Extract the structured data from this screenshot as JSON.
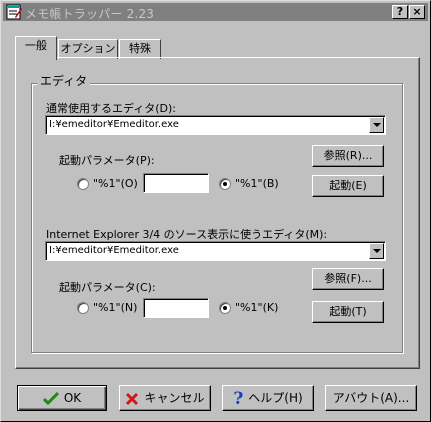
{
  "window": {
    "title": "メモ帳トラッパー 2.23",
    "help_button": "?",
    "close_button": "×"
  },
  "tabs": [
    {
      "label": "一般",
      "active": true
    },
    {
      "label": "オプション",
      "active": false
    },
    {
      "label": "特殊",
      "active": false
    }
  ],
  "group": {
    "title": "エディタ",
    "normal_editor": {
      "label": "通常使用するエディタ(D):",
      "value": "I:¥emeditor¥Emeditor.exe",
      "params_label": "起動パラメータ(P):",
      "radio_a": "\"%1\"(O)",
      "radio_a_checked": false,
      "param_value": "",
      "radio_b": "\"%1\"(B)",
      "radio_b_checked": true,
      "browse_button": "参照(R)...",
      "launch_button": "起動(E)"
    },
    "ie_editor": {
      "label": "Internet Explorer 3/4 のソース表示に使うエディタ(M):",
      "value": "I:¥emeditor¥Emeditor.exe",
      "params_label": "起動パラメータ(C):",
      "radio_a": "\"%1\"(N)",
      "radio_a_checked": false,
      "param_value": "",
      "radio_b": "\"%1\"(K)",
      "radio_b_checked": true,
      "browse_button": "参照(F)...",
      "launch_button": "起動(T)"
    }
  },
  "footer": {
    "ok": "OK",
    "cancel": "キャンセル",
    "help": "ヘルプ(H)",
    "about": "アバウト(A)..."
  },
  "colors": {
    "face": "#c0c0c0",
    "titlebar_inactive": "#808080",
    "ok_check": "#1a8a1a",
    "cancel_x": "#d01818",
    "help_q": "#1040c0"
  }
}
